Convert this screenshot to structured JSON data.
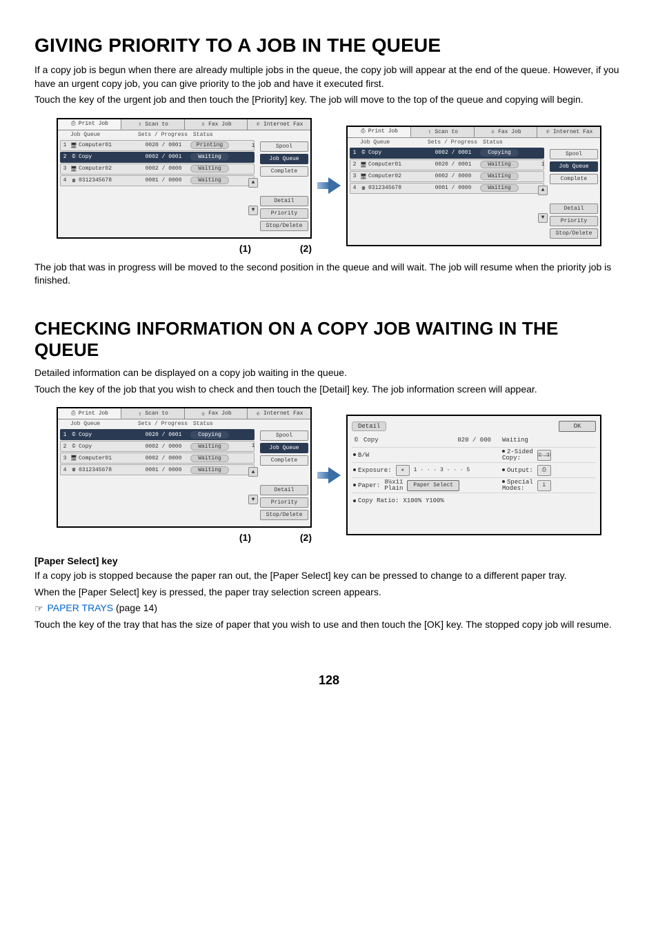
{
  "h1": "GIVING PRIORITY TO A JOB IN THE QUEUE",
  "p1": "If a copy job is begun when there are already multiple jobs in the queue, the copy job will appear at the end of the queue. However, if you have an urgent copy job, you can give priority to the job and have it executed first.",
  "p2": "Touch the key of the urgent job and then touch the [Priority] key. The job will move to the top of the queue and copying will begin.",
  "tabs": {
    "print": "Print Job",
    "scan": "Scan to",
    "fax": "Fax Job",
    "ifax": "Internet Fax"
  },
  "headers": {
    "queue": "Job Queue",
    "progress": "Sets / Progress",
    "status": "Status"
  },
  "queueA": {
    "rows": [
      {
        "n": "1",
        "name": "Computer01",
        "prog": "0020 / 0001",
        "stat": "Printing"
      },
      {
        "n": "2",
        "name": "Copy",
        "prog": "0002 / 0001",
        "stat": "Waiting"
      },
      {
        "n": "3",
        "name": "Computer02",
        "prog": "0002 / 0000",
        "stat": "Waiting"
      },
      {
        "n": "4",
        "name": "0312345678",
        "prog": "0001 / 0000",
        "stat": "Waiting"
      }
    ],
    "selectedIndex": 1
  },
  "queueB": {
    "rows": [
      {
        "n": "1",
        "name": "Copy",
        "prog": "0002 / 0001",
        "stat": "Copying"
      },
      {
        "n": "2",
        "name": "Computer01",
        "prog": "0020 / 0001",
        "stat": "Waiting"
      },
      {
        "n": "3",
        "name": "Computer02",
        "prog": "0002 / 0000",
        "stat": "Waiting"
      },
      {
        "n": "4",
        "name": "0312345678",
        "prog": "0001 / 0000",
        "stat": "Waiting"
      }
    ],
    "selectedIndex": 0
  },
  "side": {
    "spool": "Spool",
    "jobq": "Job Queue",
    "complete": "Complete",
    "detail": "Detail",
    "priority": "Priority",
    "stopdel": "Stop/Delete"
  },
  "pager": {
    "p1": "1",
    "p2": "1"
  },
  "figLabels": {
    "one": "(1)",
    "two": "(2)"
  },
  "p3": "The job that was in progress will be moved to the second position in the queue and will wait. The job will resume when the priority job is finished.",
  "h2": "CHECKING INFORMATION ON A COPY JOB WAITING IN THE QUEUE",
  "p4": "Detailed information can be displayed on a copy job waiting in the queue.",
  "p5": "Touch the key of the job that you wish to check and then touch the [Detail] key. The job information screen will appear.",
  "queueC": {
    "rows": [
      {
        "n": "1",
        "name": "Copy",
        "prog": "0020 / 0001",
        "stat": "Copying"
      },
      {
        "n": "2",
        "name": "Copy",
        "prog": "0002 / 0000",
        "stat": "Waiting"
      },
      {
        "n": "3",
        "name": "Computer01",
        "prog": "0002 / 0000",
        "stat": "Waiting"
      },
      {
        "n": "4",
        "name": "0312345678",
        "prog": "0001 / 0000",
        "stat": "Waiting"
      }
    ],
    "selectedIndex": 0
  },
  "detail": {
    "title": "Detail",
    "ok": "OK",
    "r1l1": "Copy",
    "r1l2": "020 / 000",
    "r1r": "Waiting",
    "r2l": "B/W",
    "r2rLabel": "2-Sided\nCopy:",
    "r3l": "Exposure:",
    "r3bar": "1 · · · 3 · · · 5",
    "r3r": "Output:",
    "r4l": "Paper:",
    "r4paper": "8½x11\nPlain",
    "r4btn": "Paper Select",
    "r4r": "Special\nModes:",
    "r5": "Copy Ratio:",
    "r5v": "X100% Y100%"
  },
  "subhead": "[Paper Select] key",
  "p6": "If a copy job is stopped because the paper ran out, the [Paper Select] key can be pressed to change to a different paper tray.",
  "p7": "When the [Paper Select] key is pressed, the paper tray selection screen appears.",
  "linkLine": {
    "pre": "☞ ",
    "text": "PAPER TRAYS",
    "post": " (page 14)"
  },
  "p8": "Touch the key of the tray that has the size of paper that you wish to use and then touch the [OK] key. The stopped copy job will resume.",
  "pageNum": "128"
}
